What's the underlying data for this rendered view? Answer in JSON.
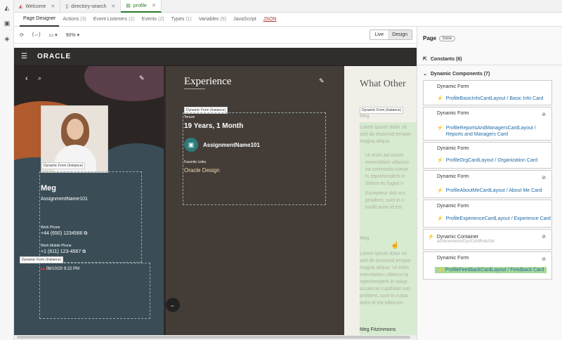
{
  "tabs": [
    {
      "label": "Welcome",
      "icon": "vb-logo-icon"
    },
    {
      "label": "directory-search",
      "icon": "file-icon"
    },
    {
      "label": "profile",
      "icon": "page-icon"
    }
  ],
  "subtabs": [
    {
      "label": "Page Designer",
      "count": ""
    },
    {
      "label": "Actions",
      "count": "(3)"
    },
    {
      "label": "Event Listeners",
      "count": "(2)"
    },
    {
      "label": "Events",
      "count": "(2)"
    },
    {
      "label": "Types",
      "count": "(1)"
    },
    {
      "label": "Variables",
      "count": "(9)"
    },
    {
      "label": "JavaScript",
      "count": ""
    },
    {
      "label": "JSON",
      "count": ""
    }
  ],
  "toolbar": {
    "zoom": "90%",
    "live": "Live",
    "design": "Design"
  },
  "canvas": {
    "brand": "ORACLE",
    "name": "Meg",
    "assignment": "AssignmentName101",
    "work_phone_label": "Work Phone",
    "work_phone": "+44 (650) 1234566",
    "mobile_label": "Work Mobile Phone",
    "mobile": "+1 (611) 123-4567",
    "datetime": "08/10/20 9:22 PM",
    "df_tag": "Dynamic Form (Instance)",
    "experience_title": "Experience",
    "tenure_label": "Tenure",
    "tenure": "19 Years, 1 Month",
    "exp_assignment": "AssignmentName101",
    "fav_links_label": "Favorite Links",
    "fav_link": "Oracle Design",
    "other_title": "What Other",
    "c3_meg": "Meg",
    "c3_l1": "Lorem ipsum dolor sit",
    "c3_l2": "sed do eiusmod tempor",
    "c3_l3": "magna aliqua.",
    "c3_b1": "Ut enim ad minim",
    "c3_b2": "exercitation ullamco",
    "c3_b3": "ea commodo conse",
    "c3_b4": "in reprehenderit in",
    "c3_b5": "dolore eu fugiat n",
    "c3_b6": "Excepteur sint occ",
    "c3_b7": "proident, sunt in c",
    "c3_b8": "mollit anim id est",
    "c3_meg2": "Meg",
    "c3_r1": "Lorem ipsum dolor sit",
    "c3_r2": "sed do eiusmod tempor",
    "c3_r3": "magna aliqua. Ut enim",
    "c3_r4": "exercitation ullamco la",
    "c3_r5": "reprehenderit in volup",
    "c3_r6": "occaecat cupidatat non",
    "c3_r7": "proident, sunt in culpa",
    "c3_r8": "anim id est laborum.",
    "c3_bottom": "Meg Fitzimmons"
  },
  "panel": {
    "title": "Page",
    "badge": "base",
    "constants": "Constants (6)",
    "dyn": "Dynamic Components (7)",
    "items": [
      {
        "title": "Dynamic Form",
        "link": "ProfileBasicInfoCardLayout / Basic Info Card",
        "hidden": false
      },
      {
        "title": "Dynamic Form",
        "link": "ProfileReportsAndManagersCardLayout /",
        "link2": "Reports and Managers Card",
        "hidden": true
      },
      {
        "title": "Dynamic Form",
        "link": "ProfileOrgCardLayout / Organization Card",
        "hidden": false
      },
      {
        "title": "Dynamic Form",
        "link": "ProfileAboutMeCardLayout / About Me Card",
        "hidden": true
      },
      {
        "title": "Dynamic Form",
        "link": "ProfileExperienceCardLayout / Experience Card",
        "hidden": false
      },
      {
        "title": "Dynamic Container",
        "sub": "achievementsDynContRuleSet",
        "hidden": true
      },
      {
        "title": "Dynamic Form",
        "link": "ProfileFeedbackCardLayout / Feedback Card",
        "hidden": true
      }
    ]
  }
}
